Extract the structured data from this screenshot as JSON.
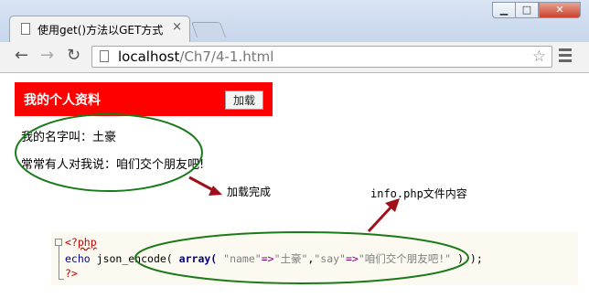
{
  "window": {
    "tab_title": "使用get()方法以GET方式",
    "tab_close": "×",
    "min_glyph": "▁",
    "max_glyph": "□",
    "close_glyph": "✕"
  },
  "nav": {
    "back_glyph": "←",
    "forward_glyph": "→",
    "reload_glyph": "↻",
    "star_glyph": "☆",
    "url_host": "localhost",
    "url_path": "/Ch7/4-1.html"
  },
  "page": {
    "title": "我的个人资料",
    "load_button": "加载",
    "line1": "我的名字叫：土豪",
    "line2": "常常有人对我说：咱们交个朋友吧!"
  },
  "annotations": {
    "load_done": "加载完成",
    "info_file": "info.php",
    "info_suffix": "文件内容"
  },
  "code": {
    "open_tag_lt": "<?",
    "open_tag_php": "php",
    "echo": "echo",
    "func": "json_encode(",
    "array": "array(",
    "key1": "\"name\"",
    "arrow1": "=>",
    "val1": "\"土豪\"",
    "comma": ",",
    "key2": "\"say\"",
    "arrow2": "=>",
    "val2": "\"咱们交个朋友吧!\"",
    "close_parens": ") );",
    "close_tag": "?>"
  },
  "icons": {
    "tab_page": "page-icon",
    "addr_page": "page-icon",
    "menu": "hamburger-menu-icon",
    "annotation_color": "#1a7a1a",
    "arrow_color": "#a0101a"
  }
}
